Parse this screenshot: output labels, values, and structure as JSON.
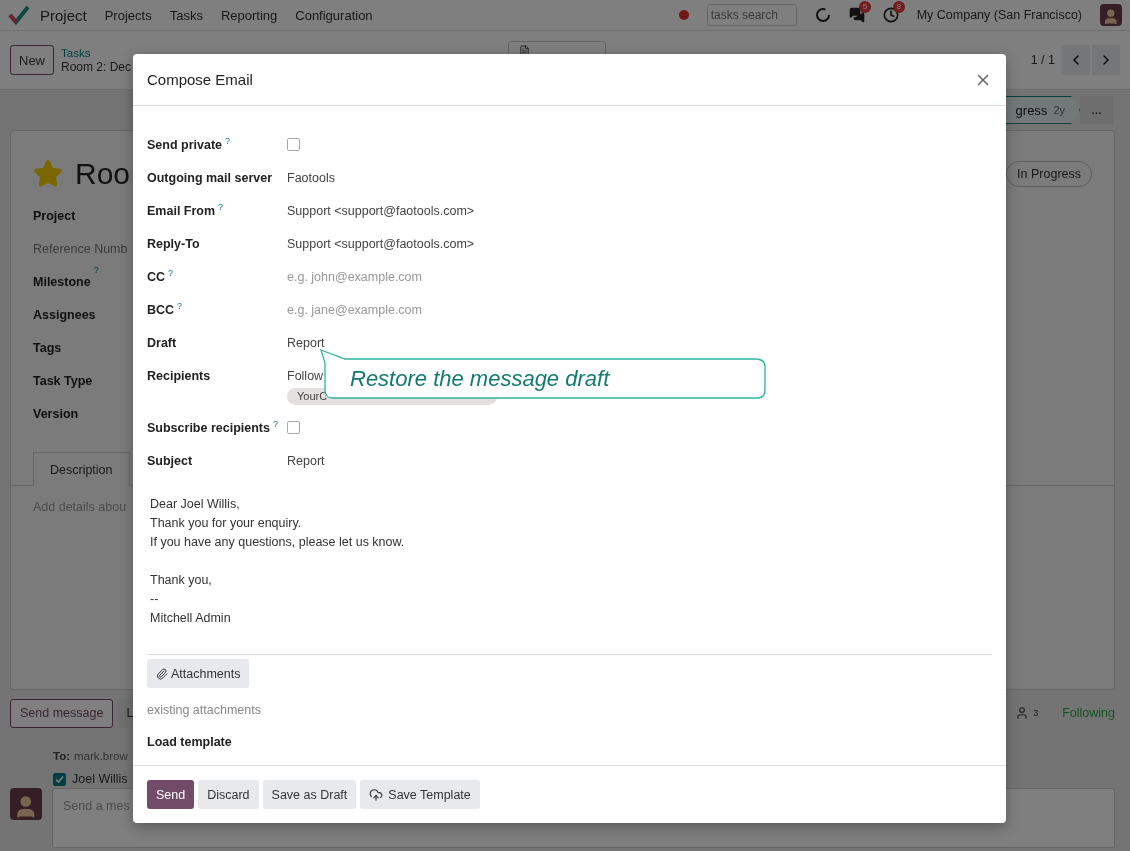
{
  "navbar": {
    "app": "Project",
    "menu": [
      "Projects",
      "Tasks",
      "Reporting",
      "Configuration"
    ],
    "search": {
      "placeholder": "tasks search"
    },
    "message_count": "5",
    "activity_count": "8",
    "company": "My Company (San Francisco)"
  },
  "control_panel": {
    "new_button": "New",
    "breadcrumb": "Tasks",
    "record": "Room 2: Dec",
    "pager": "1 / 1"
  },
  "statusbar": {
    "stage": "gress",
    "age": "2y",
    "more": "..."
  },
  "form": {
    "title": "Roo",
    "starred": true,
    "status": "In Progress",
    "fields": [
      {
        "label": "Project",
        "muted": false
      },
      {
        "label": "Reference Numb",
        "muted": true
      },
      {
        "label": "Milestone",
        "muted": false,
        "help": "?"
      },
      {
        "label": "Assignees",
        "muted": false
      },
      {
        "label": "Tags",
        "muted": false
      },
      {
        "label": "Task Type",
        "muted": false
      },
      {
        "label": "Version",
        "muted": false
      }
    ],
    "tab": "Description",
    "placeholder": "Add details abou"
  },
  "chatter": {
    "send_message": "Send message",
    "log_note": "L",
    "followers": "3",
    "following": "Following",
    "to_label": "To:",
    "to": "mark.brow",
    "recipient": {
      "name": "Joel Willis",
      "checked": true
    },
    "composer_placeholder": "Send a mes"
  },
  "dialog": {
    "title": "Compose Email",
    "fields": [
      {
        "kind": "checkbox",
        "label": "Send private",
        "help": "?",
        "checked": false
      },
      {
        "kind": "text",
        "label": "Outgoing mail server",
        "value": "Faotools"
      },
      {
        "kind": "text",
        "label": "Email From",
        "help": "?",
        "value": "Support <support@faotools.com>"
      },
      {
        "kind": "text",
        "label": "Reply-To",
        "value": "Support <support@faotools.com>"
      },
      {
        "kind": "placeholder",
        "label": "CC",
        "help": "?",
        "placeholder": "e.g. john@example.com"
      },
      {
        "kind": "placeholder",
        "label": "BCC",
        "help": "?",
        "placeholder": "e.g. jane@example.com"
      },
      {
        "kind": "draft",
        "label": "Draft",
        "value": "Report",
        "tooltip": "Restore the message draft"
      },
      {
        "kind": "recipients",
        "label": "Recipients",
        "value": "Follow",
        "tag": "YourC"
      },
      {
        "kind": "checkbox",
        "label": "Subscribe recipients",
        "help": "?",
        "checked": false
      },
      {
        "kind": "text",
        "label": "Subject",
        "value": "Report"
      }
    ],
    "body": [
      [
        "Dear Joel Willis,",
        "Thank you for your enquiry.",
        "If you have any questions, please let us know."
      ],
      [
        "Thank you,",
        "--",
        "Mitchell Admin"
      ]
    ],
    "attachments_button": "Attachments",
    "existing_attachments": "existing attachments",
    "load_template": "Load template",
    "buttons": [
      {
        "kind": "primary",
        "label": "Send"
      },
      {
        "kind": "secondary",
        "label": "Discard"
      },
      {
        "kind": "secondary",
        "label": "Save as Draft"
      },
      {
        "kind": "template",
        "label": "Save Template"
      }
    ]
  }
}
